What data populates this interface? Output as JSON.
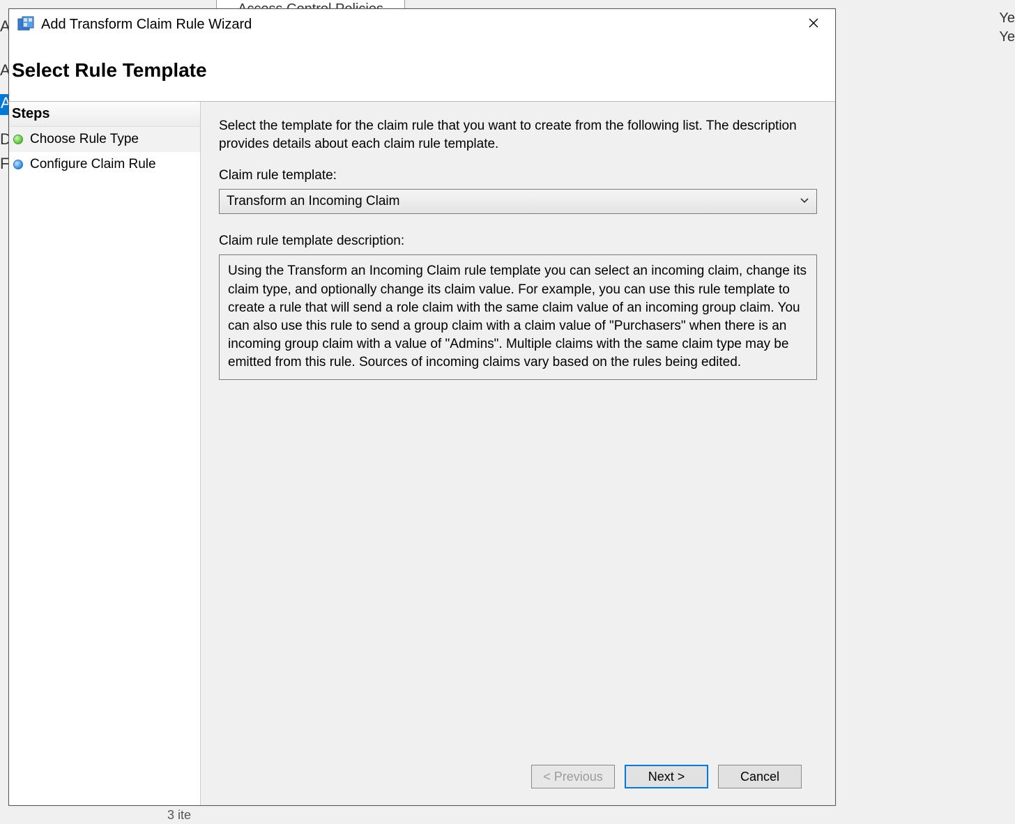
{
  "background": {
    "top_tab": "Access Control Policies",
    "left_letters": [
      "A",
      "A",
      "A",
      "D",
      "F"
    ],
    "right_fragment1": "Ye",
    "right_fragment2": "Ye",
    "bottom_fragment": "3 ite"
  },
  "dialog": {
    "title": "Add Transform Claim Rule Wizard",
    "page_title": "Select Rule Template"
  },
  "steps": {
    "header": "Steps",
    "items": [
      {
        "label": "Choose Rule Type",
        "active": true,
        "bullet": "green"
      },
      {
        "label": "Configure Claim Rule",
        "active": false,
        "bullet": "blue"
      }
    ]
  },
  "main": {
    "intro": "Select the template for the claim rule that you want to create from the following list. The description provides details about each claim rule template.",
    "template_label": "Claim rule template:",
    "template_selected": "Transform an Incoming Claim",
    "description_label": "Claim rule template description:",
    "description_text": "Using the Transform an Incoming Claim rule template you can select an incoming claim, change its claim type, and optionally change its claim value.  For example, you can use this rule template to create a rule that will send a role claim with the same claim value of an incoming group claim.  You can also use this rule to send a group claim with a claim value of \"Purchasers\" when there is an incoming group claim with a value of \"Admins\".  Multiple claims with the same claim type may be emitted from this rule.  Sources of incoming claims vary based on the rules being edited."
  },
  "footer": {
    "previous": "< Previous",
    "next": "Next >",
    "cancel": "Cancel"
  }
}
